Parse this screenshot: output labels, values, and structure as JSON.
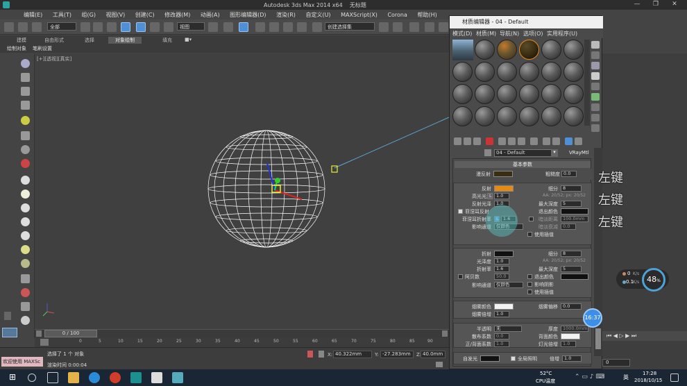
{
  "app": {
    "title": "Autodesk 3ds Max  2014 x64",
    "doc": "无标题",
    "menu": [
      "编辑(E)",
      "工具(T)",
      "组(G)",
      "视图(V)",
      "创建(C)",
      "修改器(M)",
      "动画(A)",
      "图形编辑器(D)",
      "渲染(R)",
      "自定义(U)",
      "MAXScript(X)",
      "Corona",
      "帮助(H)"
    ]
  },
  "toolbar": {
    "filter": "全部",
    "view": "视图",
    "selset": "创建选择集"
  },
  "ribbon": {
    "tabs": [
      "建模",
      "自由形式",
      "选择",
      "对象绘制",
      "填充"
    ],
    "active": "对象绘制"
  },
  "subribbon": {
    "items": [
      "绘制对象",
      "笔刷设置"
    ]
  },
  "viewport": {
    "label": "[+][透视][真实]"
  },
  "timeline": {
    "frame": "0 / 100"
  },
  "ruler": {
    "ticks": [
      "0",
      "5",
      "10",
      "15",
      "20",
      "25",
      "30",
      "35",
      "40",
      "45",
      "50",
      "55",
      "60",
      "65",
      "70",
      "75",
      "80",
      "85",
      "90",
      "95",
      "100"
    ]
  },
  "status": {
    "selected": "选择了 1 个 对象",
    "render_time": "渲染时间 0:00:04",
    "welcome": "欢迎使用 MAXSc",
    "x": "40.322mm",
    "y": "-27.283mm",
    "z": "40.0mm"
  },
  "material_editor": {
    "title": "材质编辑器 - 04 - Default",
    "menu": [
      "模式(D)",
      "材质(M)",
      "导航(N)",
      "选项(O)",
      "实用程序(U)"
    ],
    "material_name": "04 - Default",
    "material_type": "VRayMtl",
    "rollout_basic": "基本参数",
    "diffuse": {
      "label": "漫反射",
      "color": "#3a2e12"
    },
    "roughness": {
      "label": "粗糙度",
      "value": "0.0"
    },
    "reflect": {
      "label": "反射",
      "color": "#e88a10",
      "hilight_label": "高光光泽",
      "hilight_lock": "L",
      "hilight_value": "1.0",
      "gloss_label": "反射光泽",
      "gloss_value": "1.0",
      "fresnel_label": "菲涅耳反射",
      "fresnel_ior_label": "菲涅耳折射率",
      "fresnel_lock": "L",
      "fresnel_ior": "1.6",
      "affect_channels_label": "影响通道",
      "affect_channels": "仅颜色",
      "subdivs_label": "细分",
      "subdivs": "8",
      "aa_note": "AA: 20/52; px: 20/52",
      "max_depth_label": "最大深度",
      "max_depth": "5",
      "exit_color_label": "退出颜色",
      "dim_dist_label": "暗淡距离",
      "dim_dist": "100.0mm",
      "dim_falloff_label": "暗淡衰减",
      "dim_falloff": "0.0",
      "interp_label": "使用插值"
    },
    "refract": {
      "label": "折射",
      "color": "#111111",
      "gloss_label": "光泽度",
      "gloss_value": "1.0",
      "ior_label": "折射率",
      "ior": "1.6",
      "abbe_label": "阿贝数",
      "abbe": "50.0",
      "affect_channels_label": "影响通道",
      "affect_channels": "仅颜色",
      "subdivs_label": "细分",
      "subdivs": "8",
      "aa_note": "AA: 20/52; px: 20/52",
      "max_depth_label": "最大深度",
      "max_depth": "5",
      "exit_color_label": "退出颜色",
      "affect_shadows_label": "影响阴影",
      "interp_label": "使用插值"
    },
    "fog": {
      "color_label": "烟雾颜色",
      "color": "#f2f2f2",
      "mult_label": "烟雾倍增",
      "mult": "1.0",
      "bias_label": "烟雾偏移",
      "bias": "0.0"
    },
    "translucency": {
      "label": "半透明",
      "value": "无",
      "scatter_label": "散布系数",
      "scatter": "0.0",
      "fb_label": "正/背面系数",
      "fb": "1.0",
      "thickness_label": "厚度",
      "thickness": "1000.0mm",
      "back_color_label": "背面颜色",
      "light_mult_label": "灯光倍增",
      "light_mult": "1.0"
    },
    "self_illum": {
      "label": "自发光",
      "color": "#111111",
      "gi_label": "全局照明",
      "mult_label": "倍增",
      "mult": "1.0"
    }
  },
  "annotations": {
    "key_labels": [
      "左键",
      "左键",
      "左键"
    ],
    "timer": "16:37"
  },
  "overlay": {
    "net_up": "0",
    "net_up_unit": "K/s",
    "net_down": "0.1",
    "net_down_unit": "K/s",
    "percent": "48",
    "percent_unit": "%"
  },
  "taskbar": {
    "temp": "52°C",
    "temp_label": "CPU温度",
    "time": "17:28",
    "date": "2018/10/15",
    "ime": "英"
  },
  "colors": {
    "accent": "#4f8fd6",
    "orange": "#e88a10"
  }
}
